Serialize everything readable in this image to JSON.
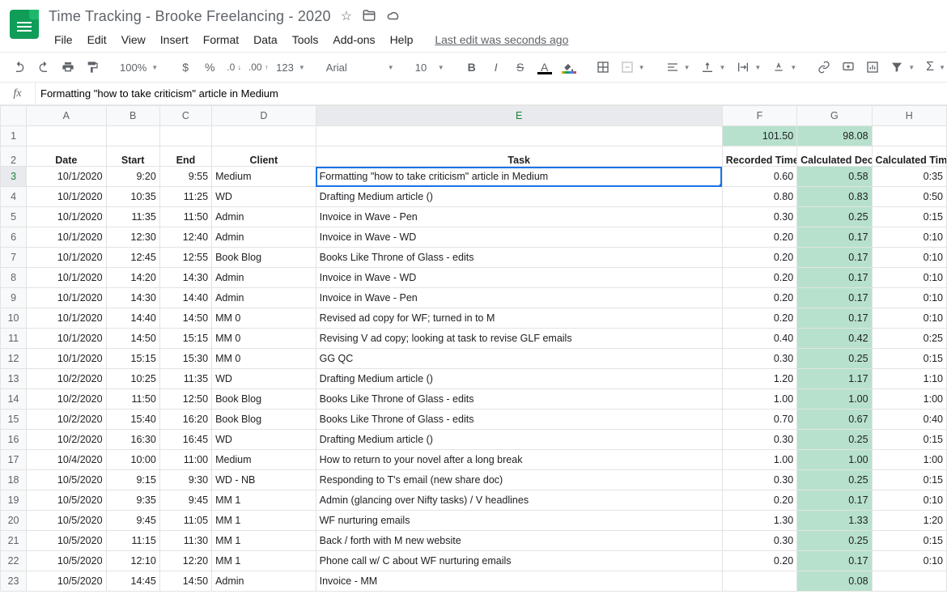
{
  "doc": {
    "title": "Time Tracking - Brooke Freelancing - 2020",
    "last_edit": "Last edit was seconds ago"
  },
  "menus": [
    "File",
    "Edit",
    "View",
    "Insert",
    "Format",
    "Data",
    "Tools",
    "Add-ons",
    "Help"
  ],
  "toolbar": {
    "zoom": "100%",
    "numberfmt": "123",
    "font": "Arial",
    "fontsize": "10"
  },
  "formula": "Formatting \"how to take criticism\" article in Medium",
  "columns": [
    "A",
    "B",
    "C",
    "D",
    "E",
    "F",
    "G",
    "H"
  ],
  "totals": {
    "F": "101.50",
    "G": "98.08"
  },
  "headers": {
    "A": "Date",
    "B": "Start",
    "C": "End",
    "D": "Client",
    "E": "Task",
    "F": "Recorded Time",
    "G": "Calculated Decimal",
    "H": "Calculated Time"
  },
  "rows": [
    {
      "n": 3,
      "A": "10/1/2020",
      "B": "9:20",
      "C": "9:55",
      "D": "Medium",
      "E": "Formatting \"how to take criticism\" article in Medium",
      "F": "0.60",
      "G": "0.58",
      "H": "0:35"
    },
    {
      "n": 4,
      "A": "10/1/2020",
      "B": "10:35",
      "C": "11:25",
      "D": "WD",
      "E": "Drafting Medium article ()",
      "F": "0.80",
      "G": "0.83",
      "H": "0:50"
    },
    {
      "n": 5,
      "A": "10/1/2020",
      "B": "11:35",
      "C": "11:50",
      "D": "Admin",
      "E": "Invoice in Wave - Pen",
      "F": "0.30",
      "G": "0.25",
      "H": "0:15"
    },
    {
      "n": 6,
      "A": "10/1/2020",
      "B": "12:30",
      "C": "12:40",
      "D": "Admin",
      "E": "Invoice in Wave - WD",
      "F": "0.20",
      "G": "0.17",
      "H": "0:10"
    },
    {
      "n": 7,
      "A": "10/1/2020",
      "B": "12:45",
      "C": "12:55",
      "D": "Book Blog",
      "E": "Books Like Throne of Glass - edits",
      "F": "0.20",
      "G": "0.17",
      "H": "0:10"
    },
    {
      "n": 8,
      "A": "10/1/2020",
      "B": "14:20",
      "C": "14:30",
      "D": "Admin",
      "E": "Invoice in Wave - WD",
      "F": "0.20",
      "G": "0.17",
      "H": "0:10"
    },
    {
      "n": 9,
      "A": "10/1/2020",
      "B": "14:30",
      "C": "14:40",
      "D": "Admin",
      "E": "Invoice in Wave - Pen",
      "F": "0.20",
      "G": "0.17",
      "H": "0:10"
    },
    {
      "n": 10,
      "A": "10/1/2020",
      "B": "14:40",
      "C": "14:50",
      "D": "MM 0",
      "E": "Revised ad copy for WF; turned in to M",
      "F": "0.20",
      "G": "0.17",
      "H": "0:10"
    },
    {
      "n": 11,
      "A": "10/1/2020",
      "B": "14:50",
      "C": "15:15",
      "D": "MM 0",
      "E": "Revising V ad copy; looking at task to revise GLF emails",
      "F": "0.40",
      "G": "0.42",
      "H": "0:25"
    },
    {
      "n": 12,
      "A": "10/1/2020",
      "B": "15:15",
      "C": "15:30",
      "D": "MM 0",
      "E": "GG QC",
      "F": "0.30",
      "G": "0.25",
      "H": "0:15"
    },
    {
      "n": 13,
      "A": "10/2/2020",
      "B": "10:25",
      "C": "11:35",
      "D": "WD",
      "E": "Drafting Medium article ()",
      "F": "1.20",
      "G": "1.17",
      "H": "1:10"
    },
    {
      "n": 14,
      "A": "10/2/2020",
      "B": "11:50",
      "C": "12:50",
      "D": "Book Blog",
      "E": "Books Like Throne of Glass - edits",
      "F": "1.00",
      "G": "1.00",
      "H": "1:00"
    },
    {
      "n": 15,
      "A": "10/2/2020",
      "B": "15:40",
      "C": "16:20",
      "D": "Book Blog",
      "E": "Books Like Throne of Glass - edits",
      "F": "0.70",
      "G": "0.67",
      "H": "0:40"
    },
    {
      "n": 16,
      "A": "10/2/2020",
      "B": "16:30",
      "C": "16:45",
      "D": "WD",
      "E": "Drafting Medium article ()",
      "F": "0.30",
      "G": "0.25",
      "H": "0:15"
    },
    {
      "n": 17,
      "A": "10/4/2020",
      "B": "10:00",
      "C": "11:00",
      "D": "Medium",
      "E": "How to return to your novel after a long break",
      "F": "1.00",
      "G": "1.00",
      "H": "1:00"
    },
    {
      "n": 18,
      "A": "10/5/2020",
      "B": "9:15",
      "C": "9:30",
      "D": "WD - NB",
      "E": "Responding to T's email (new share doc)",
      "F": "0.30",
      "G": "0.25",
      "H": "0:15"
    },
    {
      "n": 19,
      "A": "10/5/2020",
      "B": "9:35",
      "C": "9:45",
      "D": "MM 1",
      "E": "Admin (glancing over Nifty tasks) / V headlines",
      "F": "0.20",
      "G": "0.17",
      "H": "0:10"
    },
    {
      "n": 20,
      "A": "10/5/2020",
      "B": "9:45",
      "C": "11:05",
      "D": "MM 1",
      "E": "WF nurturing emails",
      "F": "1.30",
      "G": "1.33",
      "H": "1:20"
    },
    {
      "n": 21,
      "A": "10/5/2020",
      "B": "11:15",
      "C": "11:30",
      "D": "MM 1",
      "E": "Back / forth with M new website",
      "F": "0.30",
      "G": "0.25",
      "H": "0:15"
    },
    {
      "n": 22,
      "A": "10/5/2020",
      "B": "12:10",
      "C": "12:20",
      "D": "MM 1",
      "E": "Phone call w/ C about WF nurturing emails",
      "F": "0.20",
      "G": "0.17",
      "H": "0:10"
    },
    {
      "n": 23,
      "A": "10/5/2020",
      "B": "14:45",
      "C": "14:50",
      "D": "Admin",
      "E": "Invoice - MM",
      "F": "",
      "G": "0.08",
      "H": ""
    }
  ],
  "selected_cell": "E3"
}
